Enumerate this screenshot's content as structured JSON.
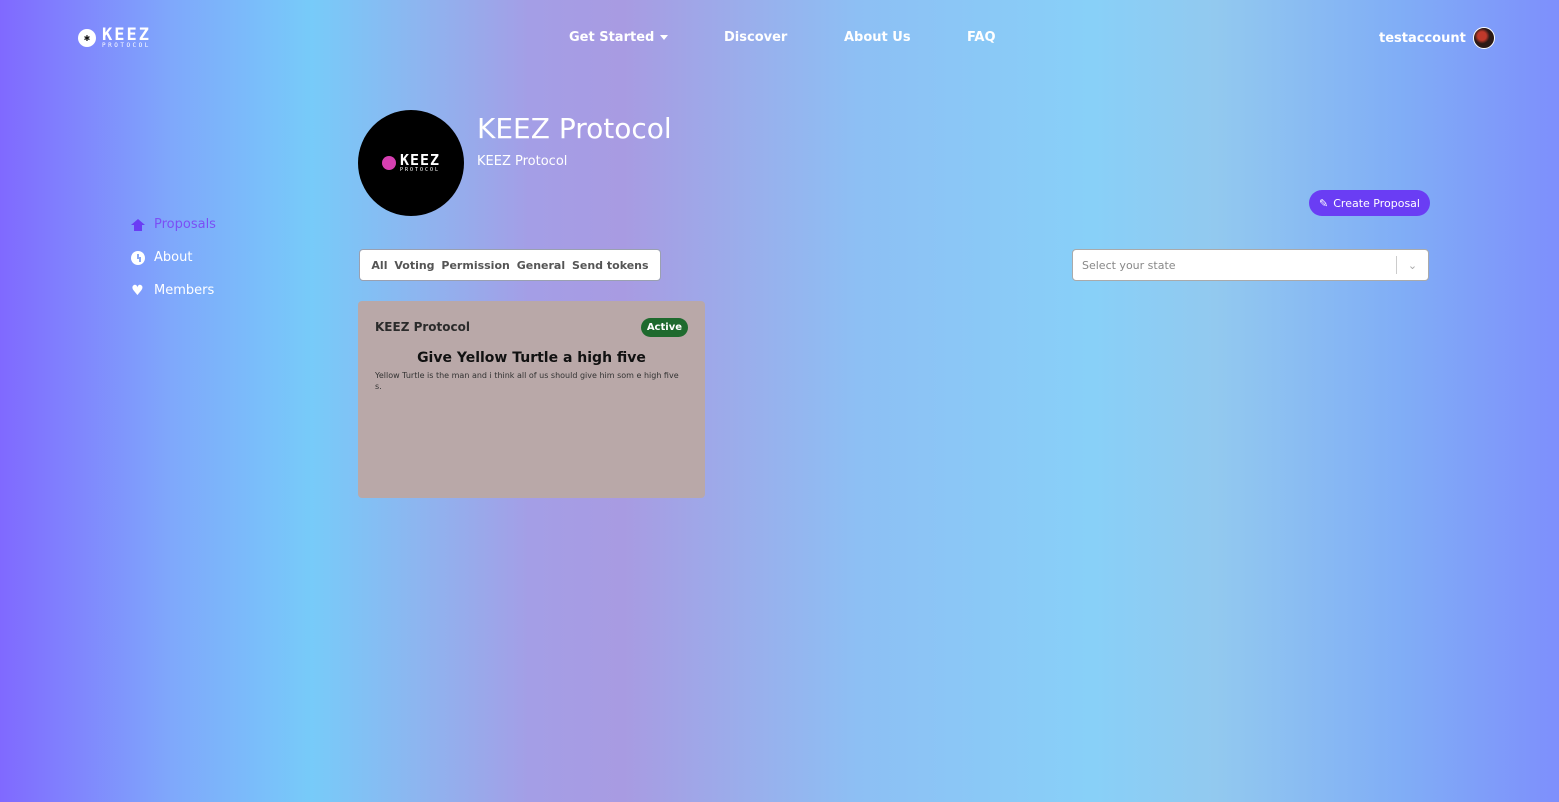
{
  "header": {
    "logo_main": "KEEZ",
    "logo_sub": "PROTOCOL",
    "logo_badge": "KEEZ",
    "nav": [
      {
        "label": "Get Started"
      },
      {
        "label": "Discover"
      },
      {
        "label": "About Us"
      },
      {
        "label": "FAQ"
      }
    ],
    "username": "testaccount"
  },
  "dao": {
    "name": "KEEZ Protocol",
    "subtitle": "KEEZ Protocol",
    "avatar_main": "KEEZ",
    "avatar_sub": "PROTOCOL"
  },
  "actions": {
    "create_label": "Create Proposal"
  },
  "sidebar": {
    "items": [
      {
        "label": "Proposals",
        "icon": "home-icon",
        "active": true
      },
      {
        "label": "About",
        "icon": "clock-icon",
        "active": false
      },
      {
        "label": "Members",
        "icon": "heart-icon",
        "active": false
      }
    ]
  },
  "filters": {
    "tabs": [
      "All",
      "Voting",
      "Permission",
      "General",
      "Send tokens"
    ],
    "state_placeholder": "Select your state"
  },
  "proposals": [
    {
      "org": "KEEZ Protocol",
      "status": "Active",
      "title": "Give Yellow Turtle a high five",
      "description": "Yellow Turtle is the man and i think all of us should give him som e high fives."
    }
  ],
  "colors": {
    "accent": "#6a3df4",
    "status_active": "#1e6a2e",
    "card_bg": "#b9a8a8"
  }
}
